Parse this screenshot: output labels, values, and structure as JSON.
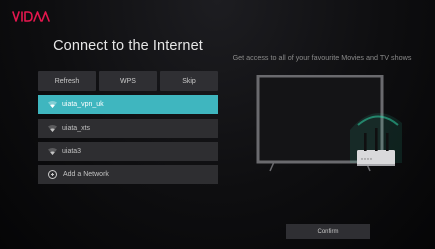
{
  "brand": {
    "logo_text": "VIDAA",
    "accent": "#e5174e"
  },
  "header": {
    "title": "Connect to the Internet"
  },
  "actions": [
    {
      "label": "Refresh"
    },
    {
      "label": "WPS"
    },
    {
      "label": "Skip"
    }
  ],
  "networks": [
    {
      "ssid": "uiata_vpn_uk",
      "selected": true,
      "icon": "wifi-icon"
    },
    {
      "ssid": "uiata_xts",
      "selected": false,
      "icon": "wifi-icon"
    },
    {
      "ssid": "uiata3",
      "selected": false,
      "icon": "wifi-icon"
    }
  ],
  "add_network": {
    "label": "Add a Network",
    "icon": "plus-circle-icon"
  },
  "promo": {
    "text": "Get access to all of your favourite Movies and TV shows"
  },
  "confirm": {
    "label": "Confirm"
  },
  "colors": {
    "highlight": "#3fb6bf",
    "router_glow": "#2fd1a6"
  }
}
